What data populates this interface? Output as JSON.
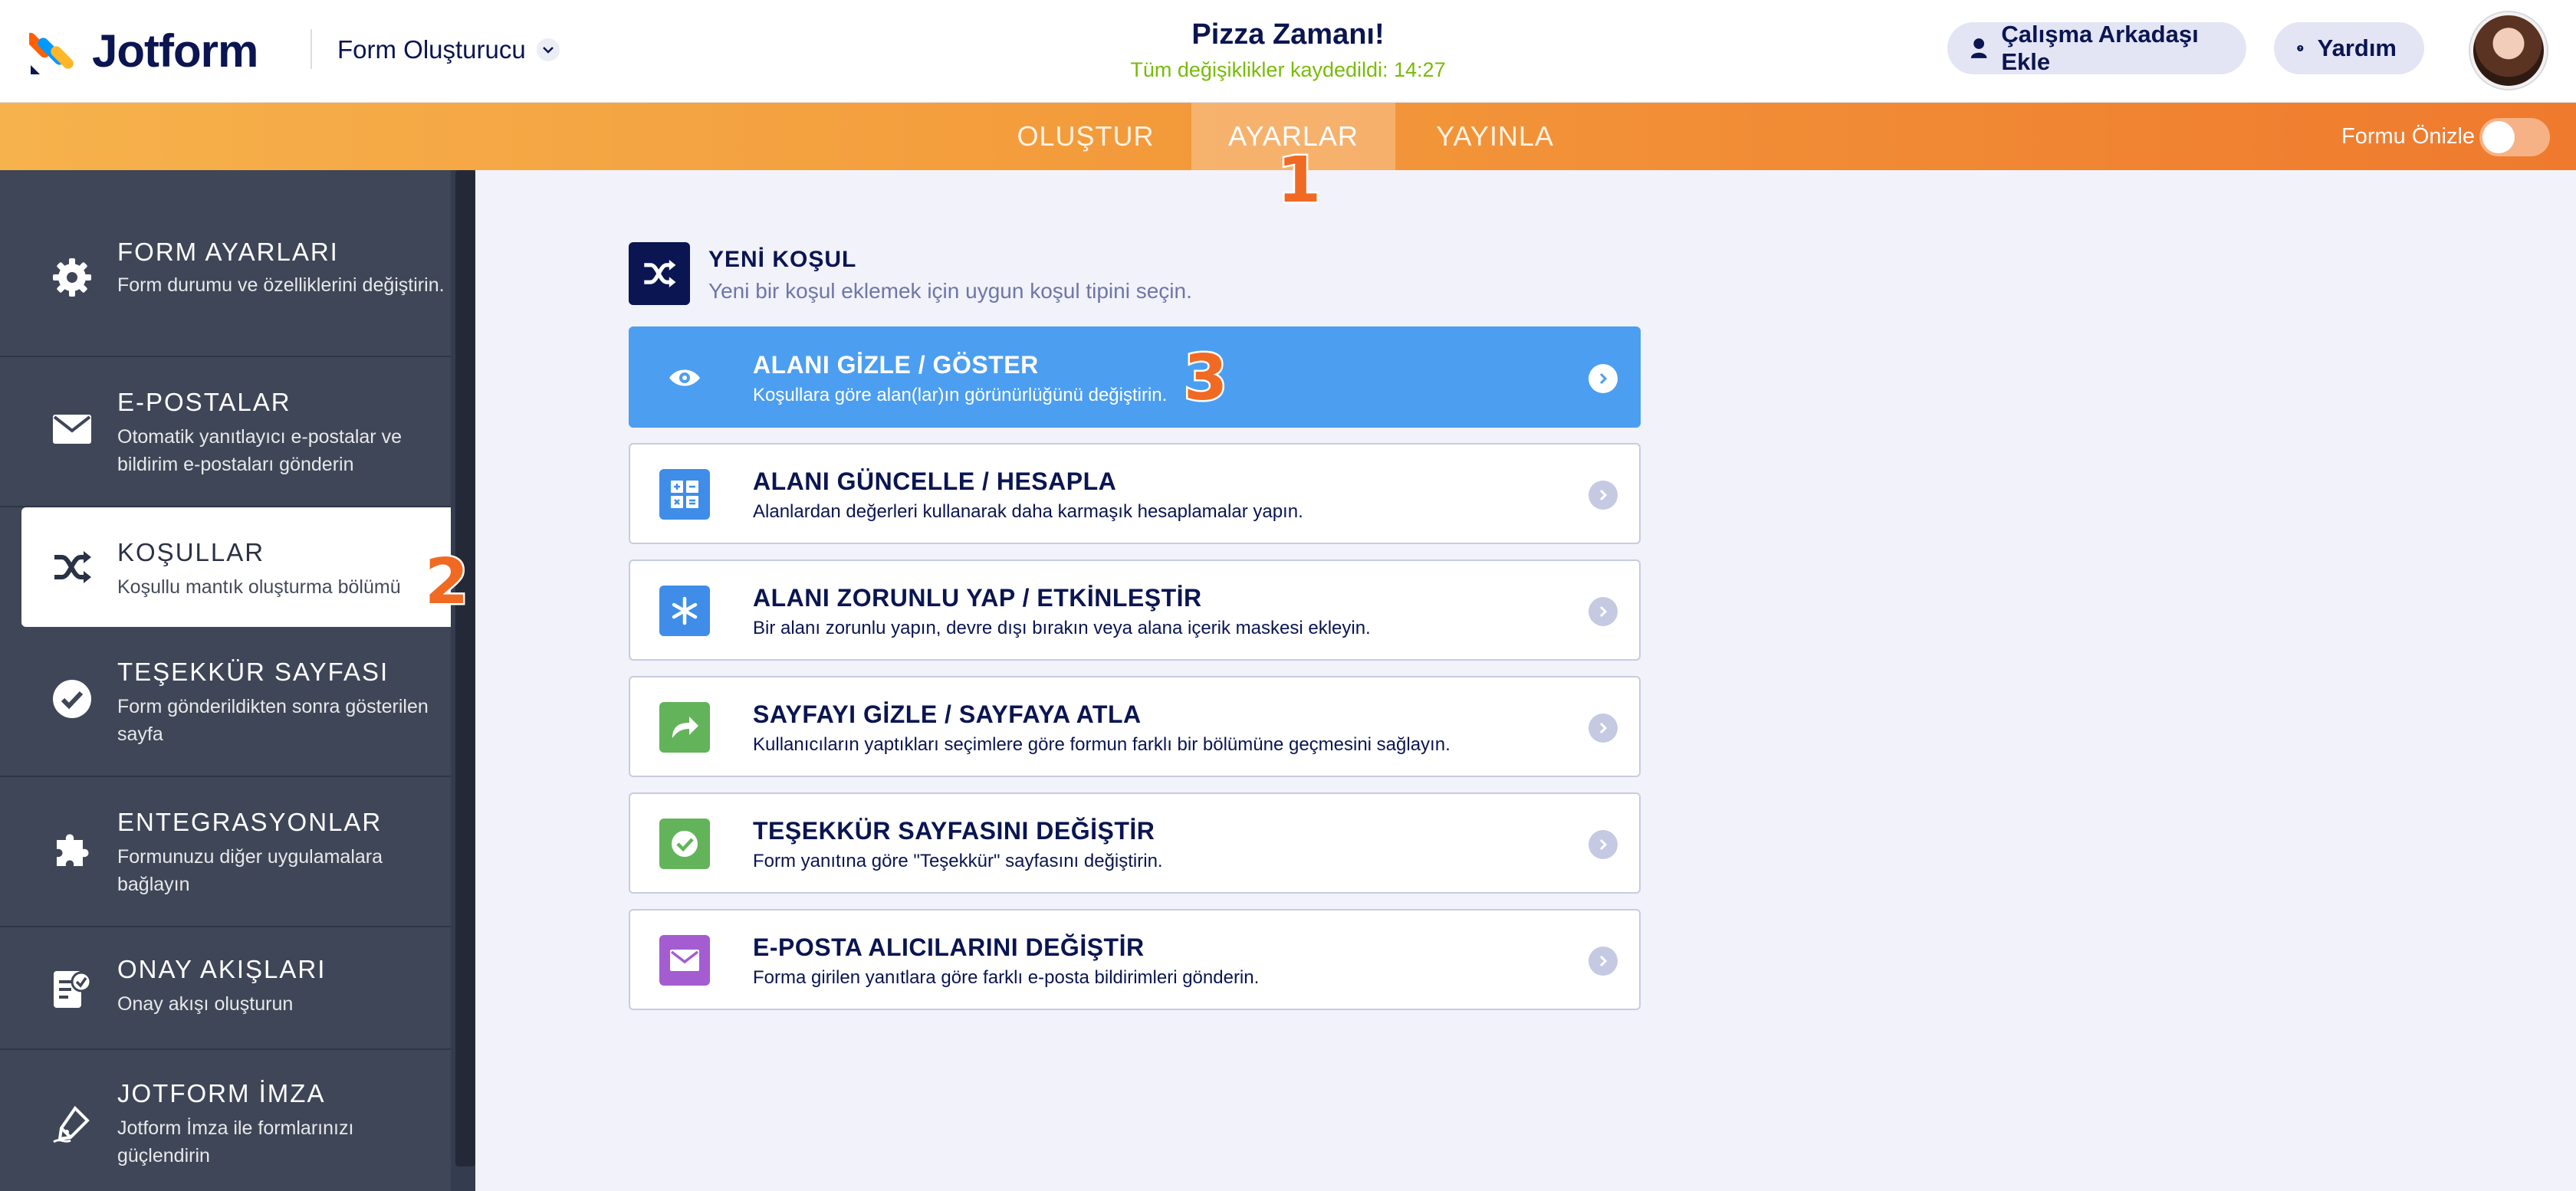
{
  "header": {
    "logo_text": "Jotform",
    "builder_dropdown": "Form Oluşturucu",
    "form_title": "Pizza Zamanı!",
    "save_status": "Tüm değişiklikler kaydedildi: 14:27",
    "collab_button": "Çalışma Arkadaşı Ekle",
    "help_button": "Yardım"
  },
  "tabs": {
    "create": "OLUŞTUR",
    "settings": "AYARLAR",
    "publish": "YAYINLA",
    "preview_label": "Formu Önizle",
    "preview_toggle_on": false
  },
  "markers": [
    "1",
    "2",
    "3"
  ],
  "sidebar": {
    "items": [
      {
        "title": "FORM AYARLARI",
        "desc": "Form durumu ve özelliklerini değiştirin.",
        "icon": "gear-icon"
      },
      {
        "title": "E-POSTALAR",
        "desc": "Otomatik yanıtlayıcı e-postalar ve bildirim e-postaları gönderin",
        "icon": "envelope-icon"
      },
      {
        "title": "KOŞULLAR",
        "desc": "Koşullu mantık oluşturma bölümü",
        "icon": "shuffle-icon",
        "active": true
      },
      {
        "title": "TEŞEKKÜR SAYFASI",
        "desc": "Form gönderildikten sonra gösterilen sayfa",
        "icon": "check-circle-icon"
      },
      {
        "title": "ENTEGRASYONLAR",
        "desc": "Formunuzu diğer uygulamalara bağlayın",
        "icon": "puzzle-icon"
      },
      {
        "title": "ONAY AKIŞLARI",
        "desc": "Onay akışı oluşturun",
        "icon": "approval-doc-icon"
      },
      {
        "title": "JOTFORM İMZA",
        "desc": "Jotform İmza ile formlarınızı güçlendirin",
        "icon": "pen-icon"
      }
    ]
  },
  "main": {
    "new_condition_title": "YENİ KOŞUL",
    "new_condition_subtitle": "Yeni bir koşul eklemek için uygun koşul tipini seçin.",
    "options": [
      {
        "title": "ALANI GİZLE / GÖSTER",
        "desc": "Koşullara göre alan(lar)ın görünürlüğünü değiştirin.",
        "icon": "eye-icon",
        "selected": true
      },
      {
        "title": "ALANI GÜNCELLE / HESAPLA",
        "desc": "Alanlardan değerleri kullanarak daha karmaşık hesaplamalar yapın.",
        "icon": "calculator-icon",
        "color": "#3f8de8"
      },
      {
        "title": "ALANI ZORUNLU YAP / ETKİNLEŞTİR",
        "desc": "Bir alanı zorunlu yapın, devre dışı bırakın veya alana içerik maskesi ekleyin.",
        "icon": "asterisk-icon",
        "color": "#3f8de8"
      },
      {
        "title": "SAYFAYI GİZLE / SAYFAYA ATLA",
        "desc": "Kullanıcıların yaptıkları seçimlere göre formun farklı bir bölümüne geçmesini sağlayın.",
        "icon": "forward-arrow-icon",
        "color": "#63b35a"
      },
      {
        "title": "TEŞEKKÜR SAYFASINI DEĞİŞTİR",
        "desc": "Form yanıtına göre \"Teşekkür\" sayfasını değiştirin.",
        "icon": "check-icon",
        "color": "#63b35a"
      },
      {
        "title": "E-POSTA ALICILARINI DEĞİŞTİR",
        "desc": "Forma girilen yanıtlara göre farklı e-posta bildirimleri gönderin.",
        "icon": "envelope-icon",
        "color": "#a45dd0"
      }
    ]
  },
  "colors": {
    "accent_orange": "#f06a23",
    "selected_blue": "#4c9ef0",
    "navy": "#0a1551",
    "saved_green": "#78bb07"
  }
}
